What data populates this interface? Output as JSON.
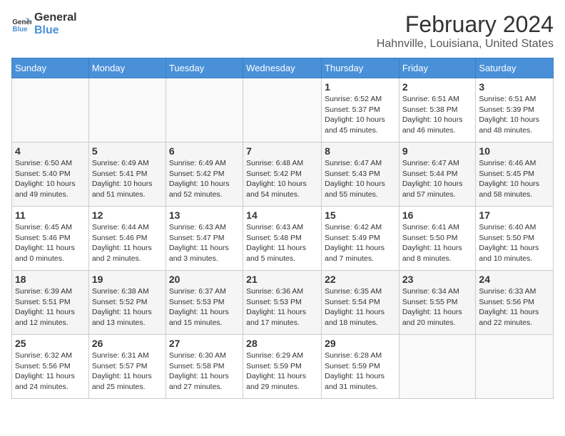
{
  "logo": {
    "line1": "General",
    "line2": "Blue"
  },
  "title": "February 2024",
  "subtitle": "Hahnville, Louisiana, United States",
  "days_of_week": [
    "Sunday",
    "Monday",
    "Tuesday",
    "Wednesday",
    "Thursday",
    "Friday",
    "Saturday"
  ],
  "weeks": [
    [
      {
        "num": "",
        "info": ""
      },
      {
        "num": "",
        "info": ""
      },
      {
        "num": "",
        "info": ""
      },
      {
        "num": "",
        "info": ""
      },
      {
        "num": "1",
        "info": "Sunrise: 6:52 AM\nSunset: 5:37 PM\nDaylight: 10 hours and 45 minutes."
      },
      {
        "num": "2",
        "info": "Sunrise: 6:51 AM\nSunset: 5:38 PM\nDaylight: 10 hours and 46 minutes."
      },
      {
        "num": "3",
        "info": "Sunrise: 6:51 AM\nSunset: 5:39 PM\nDaylight: 10 hours and 48 minutes."
      }
    ],
    [
      {
        "num": "4",
        "info": "Sunrise: 6:50 AM\nSunset: 5:40 PM\nDaylight: 10 hours and 49 minutes."
      },
      {
        "num": "5",
        "info": "Sunrise: 6:49 AM\nSunset: 5:41 PM\nDaylight: 10 hours and 51 minutes."
      },
      {
        "num": "6",
        "info": "Sunrise: 6:49 AM\nSunset: 5:42 PM\nDaylight: 10 hours and 52 minutes."
      },
      {
        "num": "7",
        "info": "Sunrise: 6:48 AM\nSunset: 5:42 PM\nDaylight: 10 hours and 54 minutes."
      },
      {
        "num": "8",
        "info": "Sunrise: 6:47 AM\nSunset: 5:43 PM\nDaylight: 10 hours and 55 minutes."
      },
      {
        "num": "9",
        "info": "Sunrise: 6:47 AM\nSunset: 5:44 PM\nDaylight: 10 hours and 57 minutes."
      },
      {
        "num": "10",
        "info": "Sunrise: 6:46 AM\nSunset: 5:45 PM\nDaylight: 10 hours and 58 minutes."
      }
    ],
    [
      {
        "num": "11",
        "info": "Sunrise: 6:45 AM\nSunset: 5:46 PM\nDaylight: 11 hours and 0 minutes."
      },
      {
        "num": "12",
        "info": "Sunrise: 6:44 AM\nSunset: 5:46 PM\nDaylight: 11 hours and 2 minutes."
      },
      {
        "num": "13",
        "info": "Sunrise: 6:43 AM\nSunset: 5:47 PM\nDaylight: 11 hours and 3 minutes."
      },
      {
        "num": "14",
        "info": "Sunrise: 6:43 AM\nSunset: 5:48 PM\nDaylight: 11 hours and 5 minutes."
      },
      {
        "num": "15",
        "info": "Sunrise: 6:42 AM\nSunset: 5:49 PM\nDaylight: 11 hours and 7 minutes."
      },
      {
        "num": "16",
        "info": "Sunrise: 6:41 AM\nSunset: 5:50 PM\nDaylight: 11 hours and 8 minutes."
      },
      {
        "num": "17",
        "info": "Sunrise: 6:40 AM\nSunset: 5:50 PM\nDaylight: 11 hours and 10 minutes."
      }
    ],
    [
      {
        "num": "18",
        "info": "Sunrise: 6:39 AM\nSunset: 5:51 PM\nDaylight: 11 hours and 12 minutes."
      },
      {
        "num": "19",
        "info": "Sunrise: 6:38 AM\nSunset: 5:52 PM\nDaylight: 11 hours and 13 minutes."
      },
      {
        "num": "20",
        "info": "Sunrise: 6:37 AM\nSunset: 5:53 PM\nDaylight: 11 hours and 15 minutes."
      },
      {
        "num": "21",
        "info": "Sunrise: 6:36 AM\nSunset: 5:53 PM\nDaylight: 11 hours and 17 minutes."
      },
      {
        "num": "22",
        "info": "Sunrise: 6:35 AM\nSunset: 5:54 PM\nDaylight: 11 hours and 18 minutes."
      },
      {
        "num": "23",
        "info": "Sunrise: 6:34 AM\nSunset: 5:55 PM\nDaylight: 11 hours and 20 minutes."
      },
      {
        "num": "24",
        "info": "Sunrise: 6:33 AM\nSunset: 5:56 PM\nDaylight: 11 hours and 22 minutes."
      }
    ],
    [
      {
        "num": "25",
        "info": "Sunrise: 6:32 AM\nSunset: 5:56 PM\nDaylight: 11 hours and 24 minutes."
      },
      {
        "num": "26",
        "info": "Sunrise: 6:31 AM\nSunset: 5:57 PM\nDaylight: 11 hours and 25 minutes."
      },
      {
        "num": "27",
        "info": "Sunrise: 6:30 AM\nSunset: 5:58 PM\nDaylight: 11 hours and 27 minutes."
      },
      {
        "num": "28",
        "info": "Sunrise: 6:29 AM\nSunset: 5:59 PM\nDaylight: 11 hours and 29 minutes."
      },
      {
        "num": "29",
        "info": "Sunrise: 6:28 AM\nSunset: 5:59 PM\nDaylight: 11 hours and 31 minutes."
      },
      {
        "num": "",
        "info": ""
      },
      {
        "num": "",
        "info": ""
      }
    ]
  ]
}
